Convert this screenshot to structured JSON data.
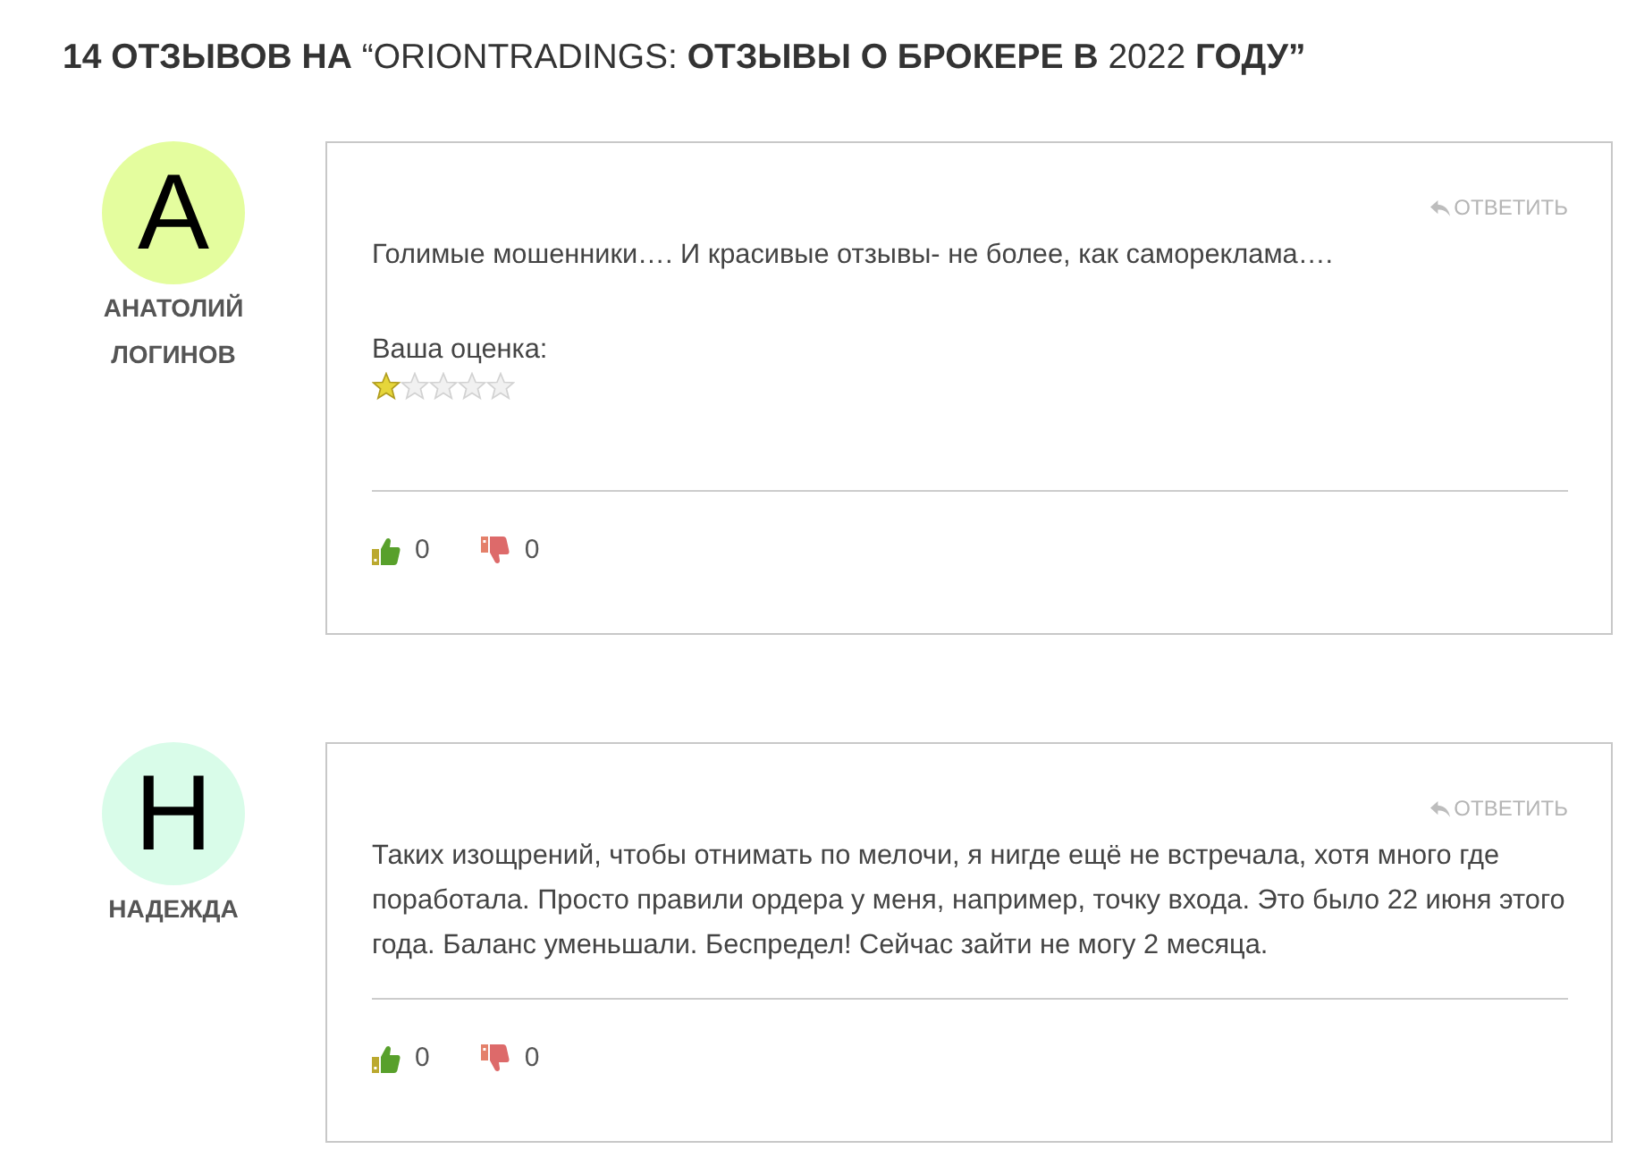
{
  "heading": "**14 ОТЗЫВОВ НА** “ORIONTRADINGS: **ОТЗЫВЫ О БРОКЕРЕ В** 2022 **ГОДУ”**",
  "comments": [
    {
      "avatar": {
        "letter": "А",
        "color": "#e4fd9e"
      },
      "author": "АНАТОЛИЙ ЛОГИНОВ",
      "reply": "ОТВЕТИТЬ",
      "text": "Голимые мошенники…. И красивые отзывы- не более, как самореклама….",
      "rating": {
        "label": "Ваша оценка:",
        "stars": 1
      },
      "votes": {
        "up": "0",
        "down": "0"
      }
    },
    {
      "avatar": {
        "letter": "Н",
        "color": "#d9fce9"
      },
      "author": "НАДЕЖДА",
      "reply": "ОТВЕТИТЬ",
      "text": "Таких изощрений, чтобы отнимать по мелочи, я нигде ещё не встречала, хотя много где поработала. Просто правили ордера у меня, например, точку входа. Это было 22 июня этого года. Баланс уменьшали. Беспредел! Сейчас зайти не могу 2 месяца.",
      "votes": {
        "up": "0",
        "down": "0"
      }
    }
  ]
}
